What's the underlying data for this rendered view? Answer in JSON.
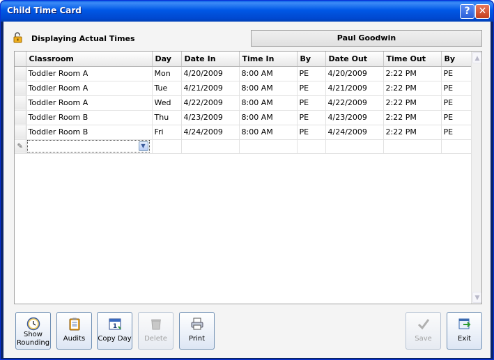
{
  "window": {
    "title": "Child Time Card",
    "help_label": "?",
    "close_label": "✕"
  },
  "status": {
    "text": "Displaying Actual Times",
    "icon": "unlocked-padlock-icon"
  },
  "child_name": "Paul Goodwin",
  "table": {
    "columns": [
      "Classroom",
      "Day",
      "Date In",
      "Time In",
      "By",
      "Date Out",
      "Time Out",
      "By"
    ],
    "rows": [
      [
        "Toddler Room A",
        "Mon",
        "4/20/2009",
        "8:00 AM",
        "PE",
        "4/20/2009",
        "2:22 PM",
        "PE"
      ],
      [
        "Toddler Room A",
        "Tue",
        "4/21/2009",
        "8:00 AM",
        "PE",
        "4/21/2009",
        "2:22 PM",
        "PE"
      ],
      [
        "Toddler Room A",
        "Wed",
        "4/22/2009",
        "8:00 AM",
        "PE",
        "4/22/2009",
        "2:22 PM",
        "PE"
      ],
      [
        "Toddler Room B",
        "Thu",
        "4/23/2009",
        "8:00 AM",
        "PE",
        "4/23/2009",
        "2:22 PM",
        "PE"
      ],
      [
        "Toddler Room B",
        "Fri",
        "4/24/2009",
        "8:00 AM",
        "PE",
        "4/24/2009",
        "2:22 PM",
        "PE"
      ]
    ]
  },
  "buttons": {
    "show_rounding": "Show Rounding",
    "audits": "Audits",
    "copy_day": "Copy Day",
    "delete": "Delete",
    "print": "Print",
    "save": "Save",
    "exit": "Exit"
  },
  "colors": {
    "title_bar": "#0058e6",
    "button_border": "#6f8fb3"
  }
}
